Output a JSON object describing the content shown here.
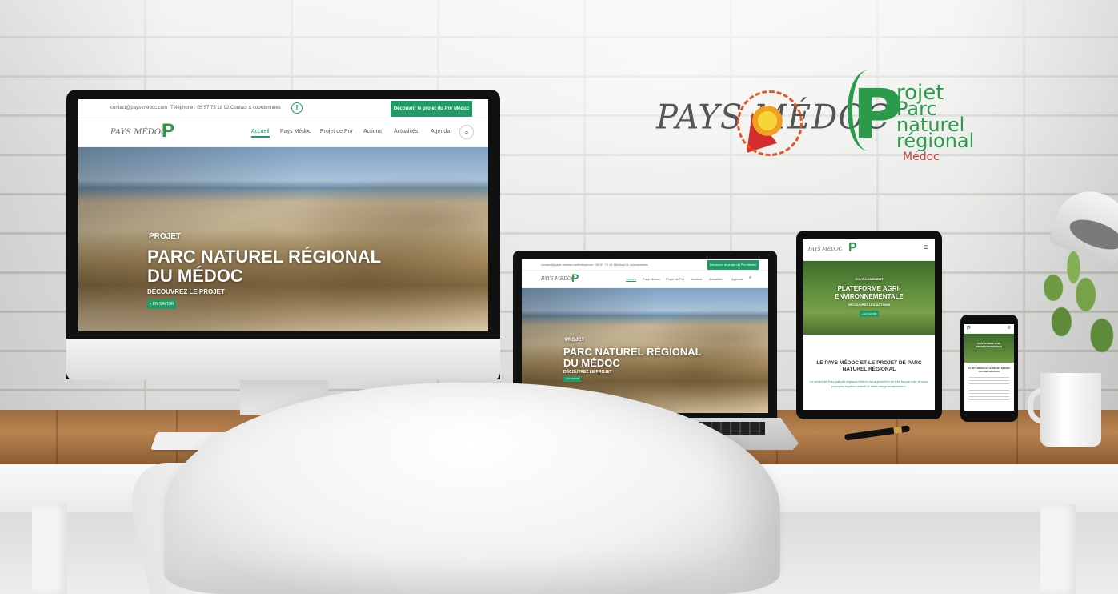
{
  "wall_logos": {
    "pays_medoc_text": "PAYS MÉDOC",
    "projet_lines": [
      "rojet",
      "Parc",
      "naturel",
      "régional",
      "Médoc"
    ],
    "projet_initial": "P"
  },
  "desktop_site": {
    "topbar": {
      "email": "contact@pays-medoc.com",
      "phone": "Téléphone : 05 57 75 18 92",
      "contact": "Contact & coordonnées",
      "cta": "Découvrir le projet du Pnr Médoc"
    },
    "nav": [
      "Accueil",
      "Pays Médoc",
      "Projet de Pnr",
      "Actions",
      "Actualités",
      "Agenda"
    ],
    "hero": {
      "kicker": "PROJET",
      "title_line1": "PARC NATUREL RÉGIONAL",
      "title_line2": "DU MÉDOC",
      "subtitle": "DÉCOUVREZ LE PROJET",
      "button": "» EN SAVOIR"
    }
  },
  "laptop_site": {
    "topbar": {
      "email": "contact@pays-medoc.com",
      "phone": "Téléphone : 05 57 75 18 92",
      "contact": "Contact & coordonnées",
      "cta": "Découvrir le projet du Pnr Médoc"
    },
    "nav": [
      "Accueil",
      "Pays Médoc",
      "Projet de Pnr",
      "Actions",
      "Actualités",
      "Agenda"
    ],
    "hero": {
      "kicker": "PROJET",
      "title_line1": "PARC NATUREL RÉGIONAL",
      "title_line2": "DU MÉDOC",
      "subtitle": "DÉCOUVREZ LE PROJET",
      "button": "» EN SAVOIR"
    }
  },
  "tablet_site": {
    "hero": {
      "kicker": "ENVIRONNEMENT",
      "title_line1": "PLATEFORME AGRI-",
      "title_line2": "ENVIRONNEMENTALE",
      "subtitle": "DÉCOUVREZ LES ACTIONS",
      "button": "» EN SAVOIR"
    },
    "section_title": "LE PAYS MÉDOC ET LE PROJET DE PARC NATUREL RÉGIONAL",
    "section_text": "Le projet de Parc naturel régional Médoc est aujourd'hui en très bonne voie et nous pouvons espérer obtenir le label très prochainement."
  },
  "phone_site": {
    "hero_title": "PLATEFORME AGRI-ENVIRONNEMENTALE",
    "section_title": "LE PAYS MÉDOC ET LE PROJET DE PARC NATUREL RÉGIONAL"
  },
  "colors": {
    "brand_green": "#1f9b63",
    "logo_green": "#2b9a4a",
    "logo_red": "#d42d2d"
  }
}
